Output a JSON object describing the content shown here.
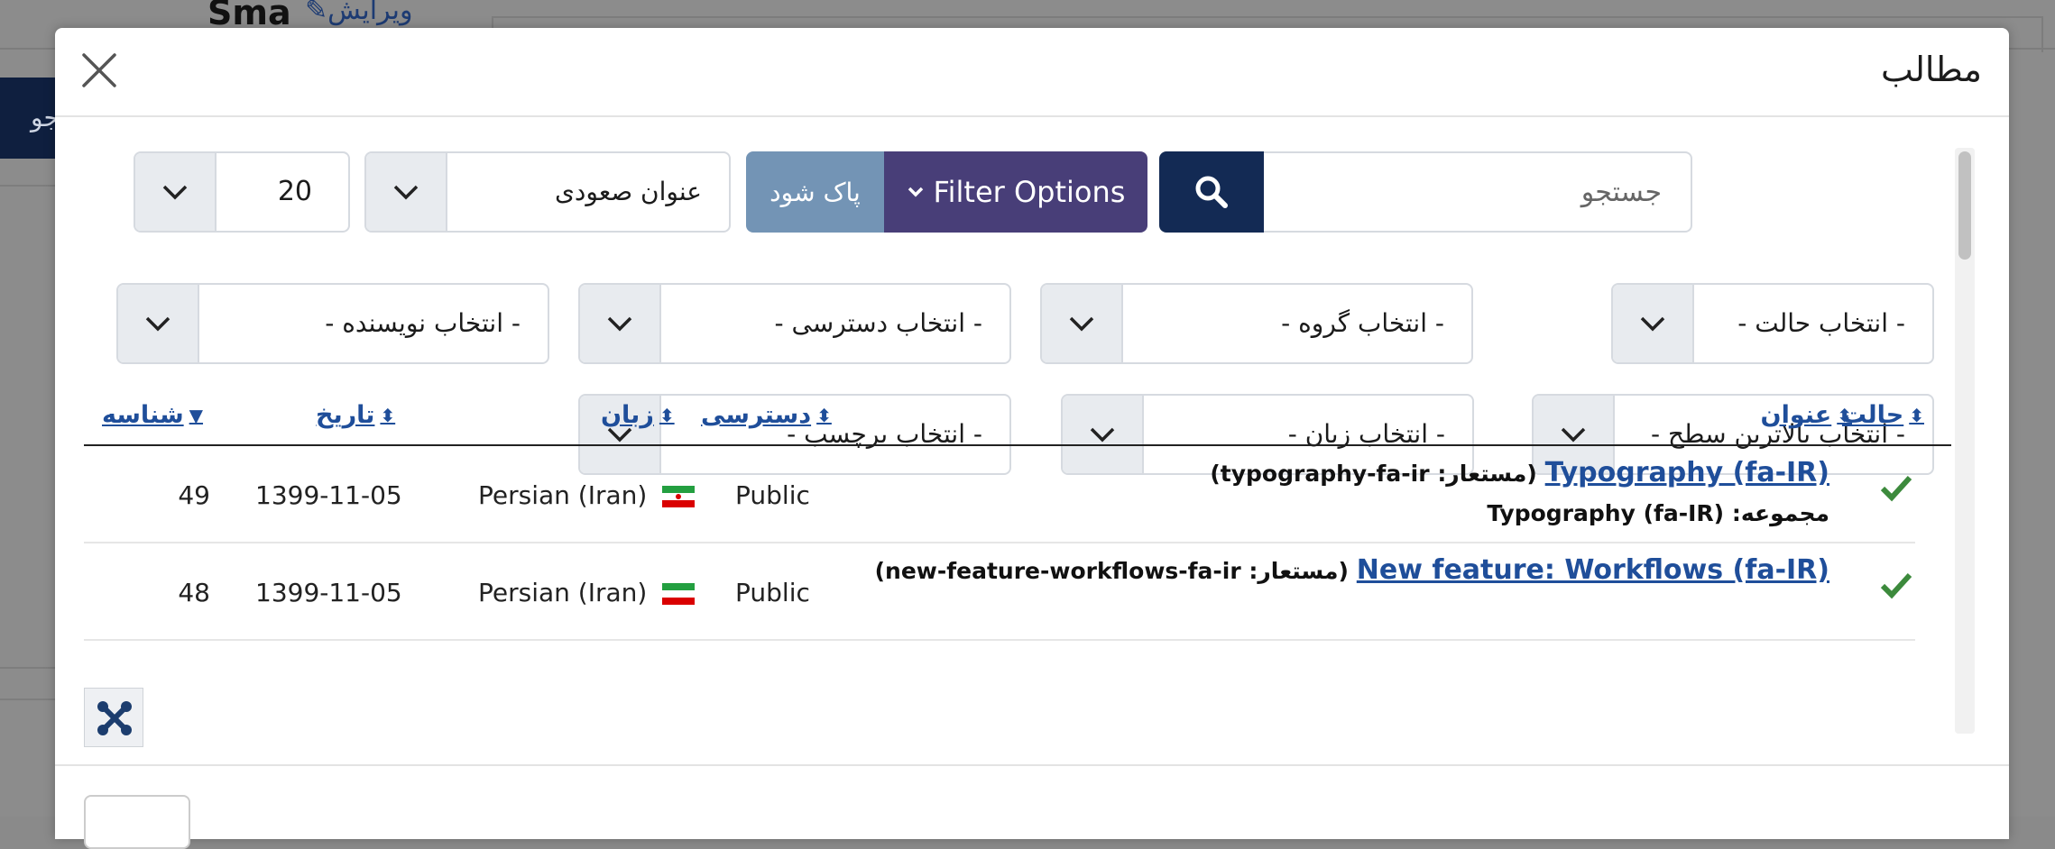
{
  "background": {
    "edit_label": "ویرایش",
    "sma_text": "Sma",
    "dark_btn_label": "جو"
  },
  "modal": {
    "title": "مطالب",
    "close_icon": "close-icon"
  },
  "toolbar": {
    "search_placeholder": "جستجو",
    "filter_options_label": "Filter Options",
    "clear_label": "پاک شود",
    "ordering_value": "عنوان صعودی",
    "limit_value": "20"
  },
  "filters": {
    "status": "- انتخاب حالت -",
    "group": "- انتخاب گروه -",
    "access": "- انتخاب دسترسی -",
    "author": "- انتخاب نویسنده -",
    "max_level": "- انتخاب بالاترین سطح -",
    "language": "- انتخاب زبان -",
    "tag": "- انتخاب برچسب -"
  },
  "table": {
    "headers": {
      "status": "حالت",
      "title": "عنوان",
      "access": "دسترسی",
      "language": "زبان",
      "date": "تاریخ",
      "id": "شناسه"
    },
    "rows": [
      {
        "title": "Typography (fa-IR)",
        "alias_label": "مستعار:",
        "alias": "typography-fa-ir",
        "group_label": "مجموعه:",
        "group": "Typography (fa-IR)",
        "access": "Public",
        "language": "Persian (Iran)",
        "date": "1399-11-05",
        "id": "49"
      },
      {
        "title": "New feature: Workflows (fa-IR)",
        "alias_label": "مستعار:",
        "alias": "new-feature-workflows-fa-ir",
        "access": "Public",
        "language": "Persian (Iran)",
        "date": "1399-11-05",
        "id": "48"
      }
    ]
  },
  "colors": {
    "primary_dark": "#132a54",
    "filter_btn": "#483e78",
    "clear_btn": "#7394b5",
    "link": "#1f4e9a",
    "check": "#3c8a3c"
  }
}
